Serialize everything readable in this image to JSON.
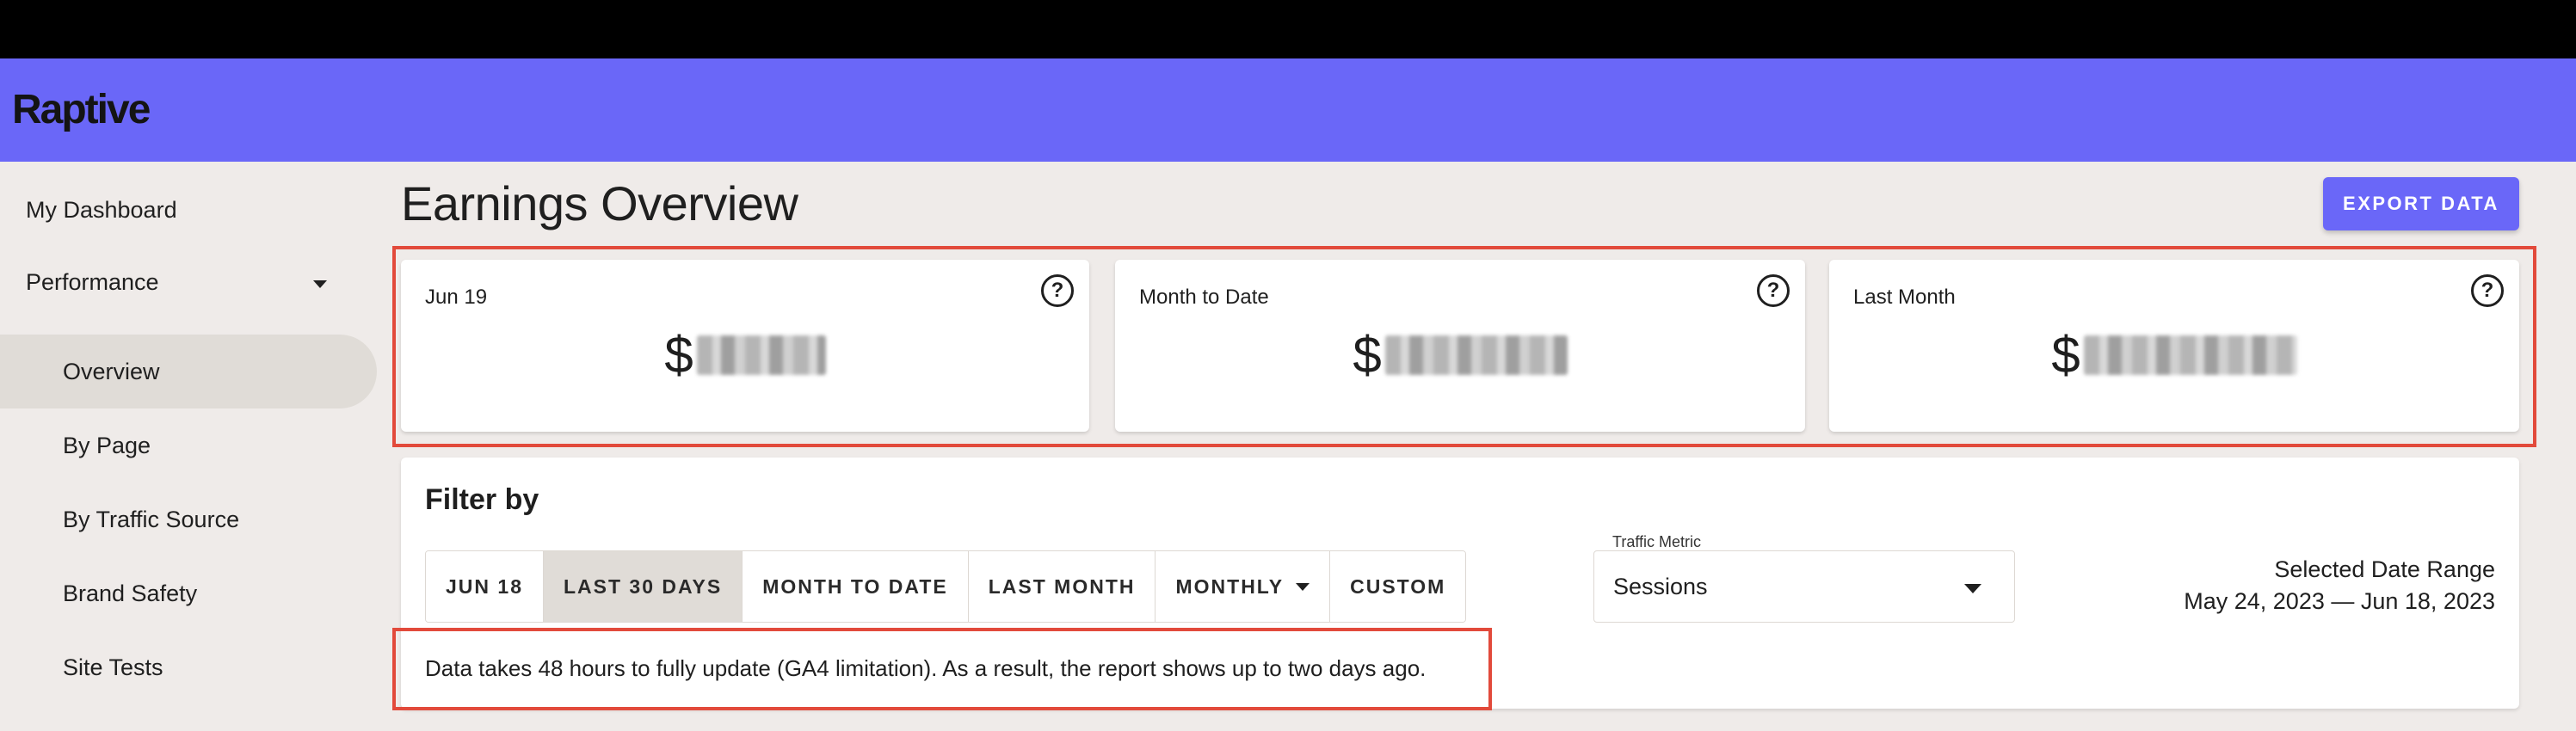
{
  "app": {
    "logo": "Raptive"
  },
  "sidebar": {
    "items": [
      {
        "label": "My Dashboard"
      },
      {
        "label": "Performance"
      },
      {
        "label": "Overview"
      },
      {
        "label": "By Page"
      },
      {
        "label": "By Traffic Source"
      },
      {
        "label": "Brand Safety"
      },
      {
        "label": "Site Tests"
      }
    ],
    "active": "Overview"
  },
  "page": {
    "title": "Earnings Overview",
    "export_label": "EXPORT DATA"
  },
  "cards": [
    {
      "label": "Jun 19",
      "currency": "$",
      "value_hidden": true
    },
    {
      "label": "Month to Date",
      "currency": "$",
      "value_hidden": true
    },
    {
      "label": "Last Month",
      "currency": "$",
      "value_hidden": true
    }
  ],
  "help_icon": {
    "glyph": "?",
    "icon": "help-circle-icon"
  },
  "filter": {
    "title": "Filter by",
    "buttons": [
      {
        "label": "JUN 18"
      },
      {
        "label": "LAST 30 DAYS"
      },
      {
        "label": "MONTH TO DATE"
      },
      {
        "label": "LAST MONTH"
      },
      {
        "label": "MONTHLY"
      },
      {
        "label": "CUSTOM"
      }
    ],
    "selected": "LAST 30 DAYS",
    "traffic_metric_label": "Traffic Metric",
    "traffic_metric_value": "Sessions",
    "date_range_label": "Selected Date Range",
    "date_range_value": "May 24, 2023 — Jun 18, 2023"
  },
  "notice": "Data takes 48 hours to fully update (GA4 limitation). As a result, the report shows up to two days ago.",
  "colors": {
    "brand": "#6a67f8",
    "highlight": "#e24a3b",
    "background": "#efebe9",
    "active_nav": "#e0dcd7"
  }
}
